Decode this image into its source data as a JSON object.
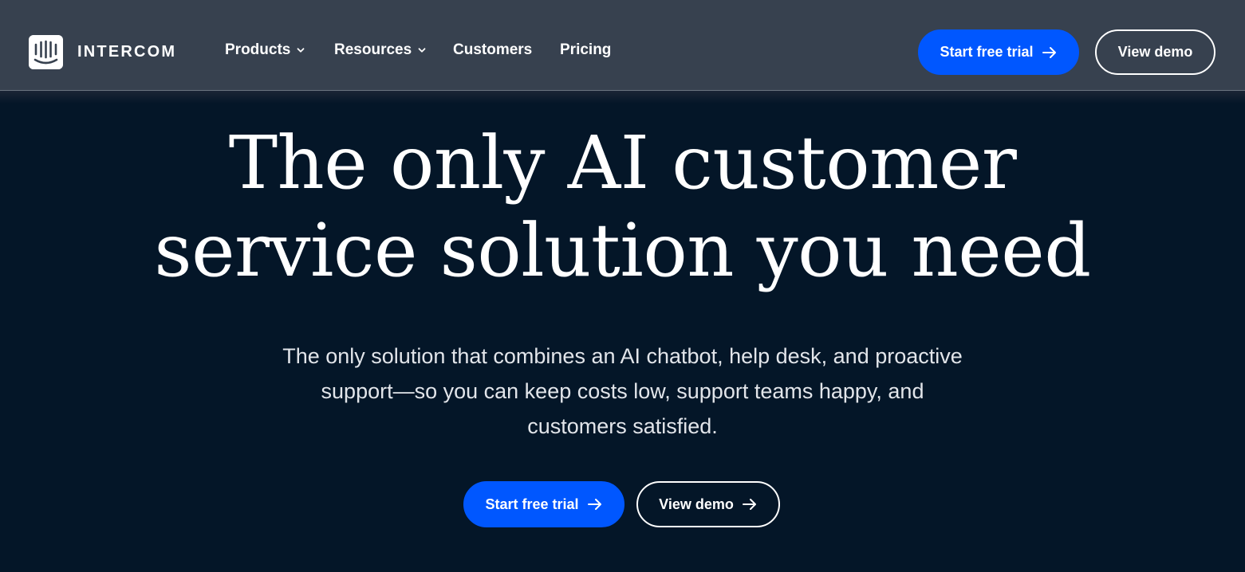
{
  "brand": {
    "name": "INTERCOM",
    "logo_icon": "intercom-smile-logo-icon"
  },
  "nav": {
    "items": [
      {
        "label": "Products",
        "has_dropdown": true,
        "icon": "chevron-down-icon"
      },
      {
        "label": "Resources",
        "has_dropdown": true,
        "icon": "chevron-down-icon"
      },
      {
        "label": "Customers",
        "has_dropdown": false
      },
      {
        "label": "Pricing",
        "has_dropdown": false
      }
    ]
  },
  "header_actions": {
    "start_trial_label": "Start free trial",
    "start_trial_icon": "arrow-right-icon",
    "view_demo_label": "View demo"
  },
  "hero": {
    "title_line1": "The only AI customer",
    "title_line2": "service solution you need",
    "subtitle_line1": "The only solution that combines an AI chatbot, help desk, and proactive",
    "subtitle_line2": "support—so you can keep costs low, support teams happy, and",
    "subtitle_line3": "customers satisfied.",
    "start_trial_label": "Start free trial",
    "view_demo_label": "View demo",
    "button_icon": "arrow-right-icon"
  },
  "colors": {
    "header_bg": "#37414f",
    "page_bg": "#041628",
    "accent_blue": "#0057ff",
    "text_primary": "#ffffff",
    "text_secondary": "#e2e5ea"
  }
}
